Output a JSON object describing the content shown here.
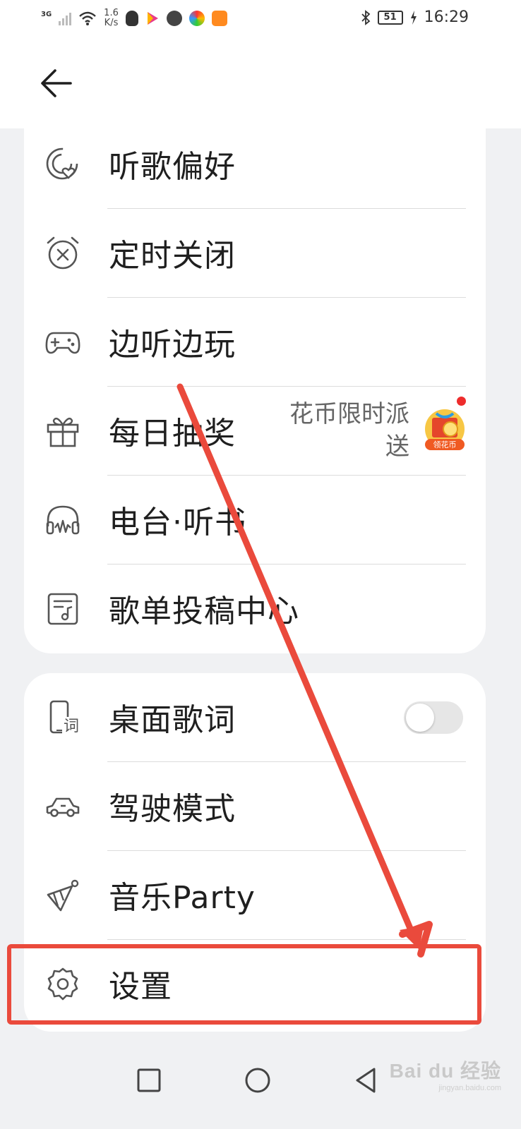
{
  "status_bar": {
    "network": "3G",
    "speed_value": "1.6",
    "speed_unit": "K/s",
    "battery": "51",
    "time": "16:29"
  },
  "header": {
    "back_icon": "arrow-left-icon"
  },
  "group1": [
    {
      "label": "听歌偏好",
      "icon": "headphone-heart-icon"
    },
    {
      "label": "定时关闭",
      "icon": "alarm-clock-icon"
    },
    {
      "label": "边听边玩",
      "icon": "gamepad-icon"
    },
    {
      "label": "每日抽奖",
      "icon": "gift-icon"
    },
    {
      "label": "电台·听书",
      "icon": "radio-headphone-icon"
    },
    {
      "label": "歌单投稿中心",
      "icon": "playlist-note-icon"
    }
  ],
  "lottery_promo": {
    "text_line1": "花币限时派",
    "text_line2": "送",
    "badge_text": "领花币"
  },
  "group2": [
    {
      "label": "桌面歌词",
      "icon": "phone-lyric-icon",
      "toggle_on": false
    },
    {
      "label": "驾驶模式",
      "icon": "car-icon"
    },
    {
      "label": "音乐Party",
      "icon": "party-hat-icon"
    },
    {
      "label": "设置",
      "icon": "gear-icon"
    }
  ],
  "desktop_lyric_icon_char": "词",
  "colors": {
    "annotation": "#ea4a3c",
    "background": "#f0f1f3",
    "card": "#ffffff"
  },
  "watermark": {
    "brand": "Bai du 经验",
    "url": "jingyan.baidu.com"
  }
}
